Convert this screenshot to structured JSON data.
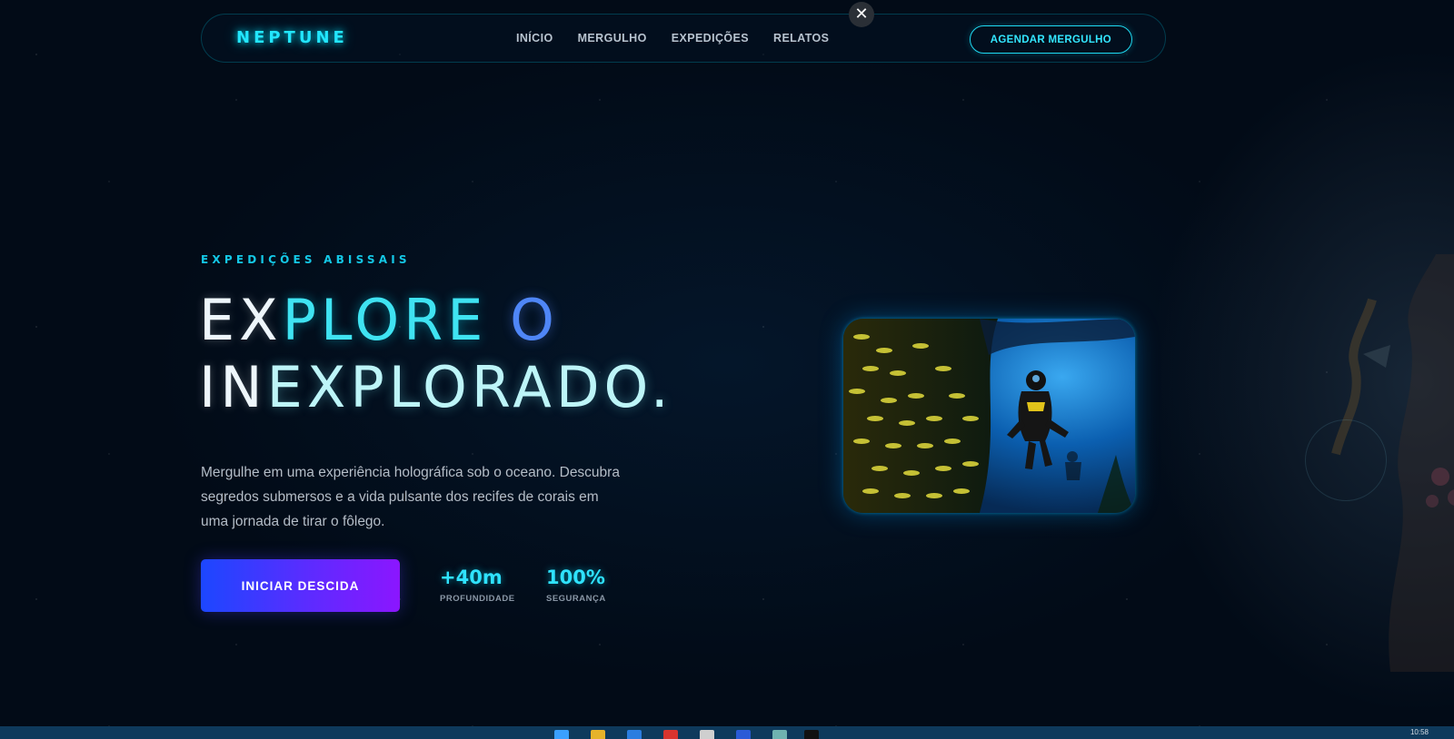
{
  "nav": {
    "logo": "NEPTUNE",
    "links": [
      "INÍCIO",
      "MERGULHO",
      "EXPEDIÇÕES",
      "RELATOS"
    ],
    "cta_label": "AGENDAR MERGULHO"
  },
  "overlay": {
    "close_icon": "close-icon"
  },
  "hero": {
    "eyebrow": "EXPEDIÇÕES ABISSAIS",
    "title_parts": [
      "EX",
      "PLORE",
      "O",
      "IN",
      "EXPLORADO."
    ],
    "description": "Mergulhe em uma experiência holográfica sob o oceano. Descubra segredos submersos e a vida pulsante dos recifes de corais em uma jornada de tirar o fôlego.",
    "cta_label": "INICIAR DESCIDA",
    "stats": [
      {
        "value": "+40m",
        "label": "PROFUNDIDADE"
      },
      {
        "value": "100%",
        "label": "SEGURANÇA"
      }
    ]
  },
  "media": {
    "photo_icon": "diver-photo"
  },
  "taskbar": {
    "time": "10:58"
  },
  "colors": {
    "accent_cyan": "#22e6ff",
    "accent_blue": "#4f86f7",
    "cta_gradient_start": "#1c47ff",
    "cta_gradient_end": "#8b16ff",
    "background": "#020b17"
  }
}
